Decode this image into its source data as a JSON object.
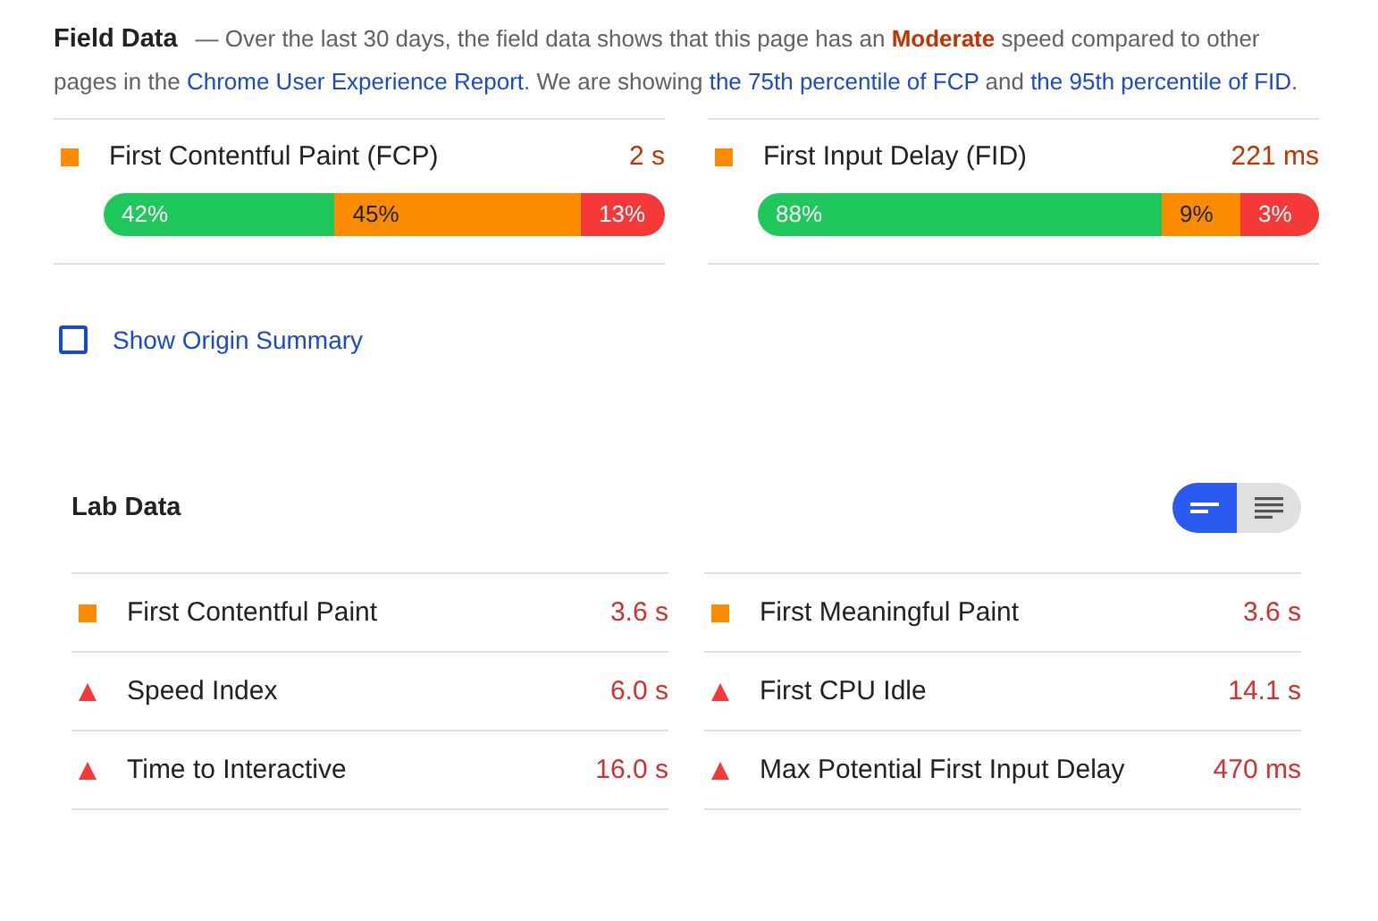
{
  "field_data": {
    "title": "Field Data",
    "description": [
      {
        "kind": "text",
        "text": "— Over the last 30 days, the field data shows that this page has an "
      },
      {
        "kind": "rating",
        "text": "Moderate"
      },
      {
        "kind": "text",
        "text": " speed compared to other pages in the "
      },
      {
        "kind": "link",
        "text": "Chrome User Experience Report"
      },
      {
        "kind": "text",
        "text": ". We are showing "
      },
      {
        "kind": "link",
        "text": "the 75th percentile of FCP"
      },
      {
        "kind": "text",
        "text": " and "
      },
      {
        "kind": "link",
        "text": "the 95th percentile of FID"
      },
      {
        "kind": "text",
        "text": "."
      }
    ],
    "metrics": [
      {
        "name": "First Contentful Paint (FCP)",
        "value": "2 s",
        "kind": "square",
        "distribution": [
          {
            "kind": "fast",
            "label": "42%"
          },
          {
            "kind": "average",
            "label": "45%"
          },
          {
            "kind": "slow",
            "label": "13%"
          }
        ]
      },
      {
        "name": "First Input Delay (FID)",
        "value": "221 ms",
        "kind": "square",
        "distribution": [
          {
            "kind": "fast",
            "label": "88%"
          },
          {
            "kind": "average",
            "label": "9%"
          },
          {
            "kind": "slow",
            "label": "3%"
          }
        ]
      }
    ]
  },
  "origin_summary": {
    "label": "Show Origin Summary",
    "checked": false
  },
  "lab_data": {
    "title": "Lab Data",
    "view_toggle": [
      {
        "kind": "compact",
        "selected": true
      },
      {
        "kind": "expanded",
        "selected": false
      }
    ],
    "metrics": [
      {
        "name": "First Contentful Paint",
        "value": "3.6 s",
        "kind": "square"
      },
      {
        "name": "First Meaningful Paint",
        "value": "3.6 s",
        "kind": "square"
      },
      {
        "name": "Speed Index",
        "value": "6.0 s",
        "kind": "triangle"
      },
      {
        "name": "First CPU Idle",
        "value": "14.1 s",
        "kind": "triangle"
      },
      {
        "name": "Time to Interactive",
        "value": "16.0 s",
        "kind": "triangle"
      },
      {
        "name": "Max Potential First Input Delay",
        "value": "470 ms",
        "kind": "triangle"
      }
    ]
  }
}
